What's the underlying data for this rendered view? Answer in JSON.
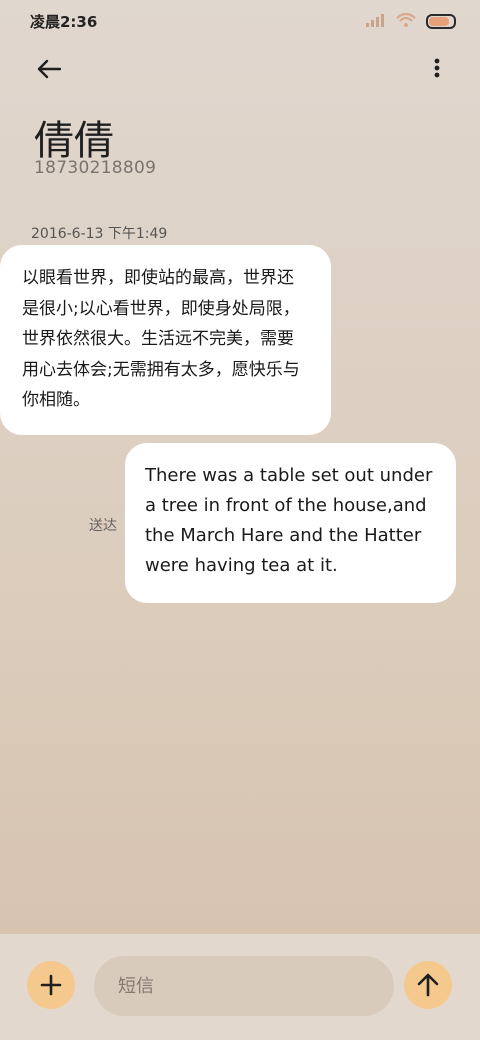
{
  "status_bar": {
    "time": "凌晨2:36",
    "battery_level": 0.85
  },
  "header": {
    "contact_name": "倩倩",
    "contact_number": "18730218809"
  },
  "conversation": {
    "timestamp": "2016-6-13 下午1:49",
    "incoming_message": "以眼看世界，即使站的最高，世界还是很小;以心看世界，即使身处局限，世界依然很大。生活远不完美，需要用心去体会;无需拥有太多，愿快乐与你相随。",
    "outgoing_message": "There was a table set out under a tree in front of the house,and the March Hare and the Hatter were having tea at it.",
    "delivery_status": "送达"
  },
  "compose": {
    "placeholder": "短信",
    "value": ""
  }
}
